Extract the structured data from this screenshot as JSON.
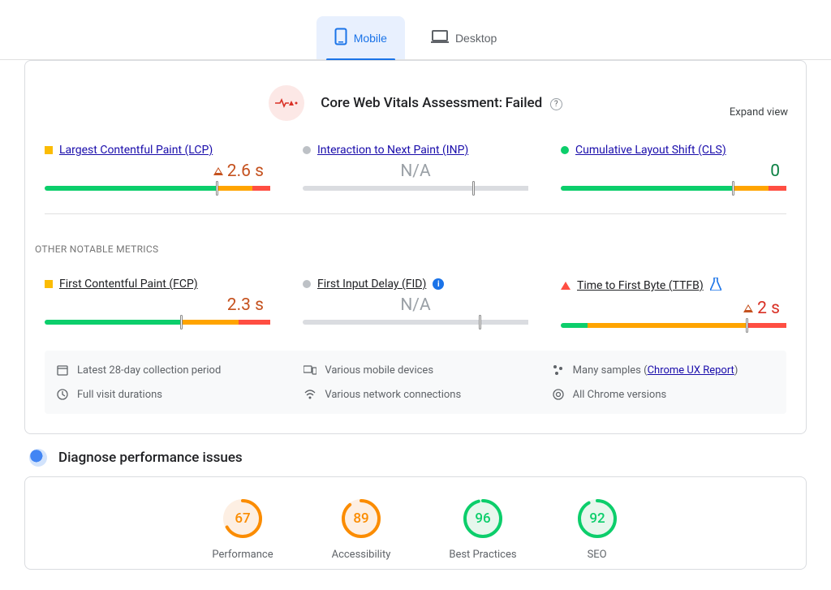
{
  "tabs": {
    "mobile": "Mobile",
    "desktop": "Desktop"
  },
  "assessment": {
    "title": "Core Web Vitals Assessment:",
    "status": "Failed"
  },
  "expand_label": "Expand view",
  "other_label": "OTHER NOTABLE METRICS",
  "metrics": {
    "lcp": {
      "title": "Largest Contentful Paint (LCP)",
      "value": "2.6 s"
    },
    "inp": {
      "title": "Interaction to Next Paint (INP)",
      "value": "N/A"
    },
    "cls": {
      "title": "Cumulative Layout Shift (CLS)",
      "value": "0"
    },
    "fcp": {
      "title": "First Contentful Paint (FCP)",
      "value": "2.3 s"
    },
    "fid": {
      "title": "First Input Delay (FID)",
      "value": "N/A"
    },
    "ttfb": {
      "title": "Time to First Byte (TTFB)",
      "value": "2 s"
    }
  },
  "footer": {
    "period": "Latest 28-day collection period",
    "devices": "Various mobile devices",
    "samples_prefix": "Many samples",
    "samples_link": "Chrome UX Report",
    "visit": "Full visit durations",
    "network": "Various network connections",
    "chrome": "All Chrome versions"
  },
  "diagnose": {
    "title": "Diagnose performance issues"
  },
  "gauges": {
    "performance": {
      "score": "67",
      "label": "Performance",
      "color": "#fb8c00",
      "bg": "#fdefe3"
    },
    "accessibility": {
      "score": "89",
      "label": "Accessibility",
      "color": "#fb8c00",
      "bg": "#fdefe3"
    },
    "best": {
      "score": "96",
      "label": "Best Practices",
      "color": "#0cce6b",
      "bg": "#e7f7ed"
    },
    "seo": {
      "score": "92",
      "label": "SEO",
      "color": "#0cce6b",
      "bg": "#e7f7ed"
    }
  }
}
